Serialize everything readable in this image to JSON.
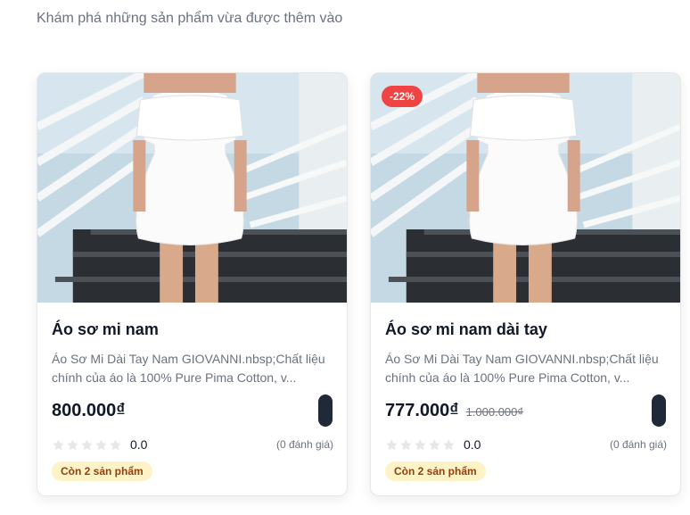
{
  "header": {
    "subtitle": "Khám phá những sản phẩm vừa được thêm vào"
  },
  "products": [
    {
      "title": "Áo sơ mi nam",
      "description": "Áo Sơ Mi Dài Tay Nam GIOVANNI.nbsp;Chất liệu chính của áo là 100% Pure Pima Cotton, v...",
      "price": "800.000₫",
      "old_price": "",
      "discount": "",
      "rating": "0.0",
      "reviews": "(0 đánh giá)",
      "stock": "Còn 2 sản phẩm",
      "image_icon": "dress-photo"
    },
    {
      "title": "Áo sơ mi nam dài tay",
      "description": "Áo Sơ Mi Dài Tay Nam GIOVANNI.nbsp;Chất liệu chính của áo là 100% Pure Pima Cotton, v...",
      "price": "777.000₫",
      "old_price": "1.000.000₫",
      "discount": "-22%",
      "rating": "0.0",
      "reviews": "(0 đánh giá)",
      "stock": "Còn 2 sản phẩm",
      "image_icon": "dress-photo"
    }
  ],
  "colors": {
    "badge_red": "#ef4444",
    "cart_button": "#1f2937",
    "stock_bg": "#fef3c7",
    "star_empty": "#e5e7eb"
  }
}
